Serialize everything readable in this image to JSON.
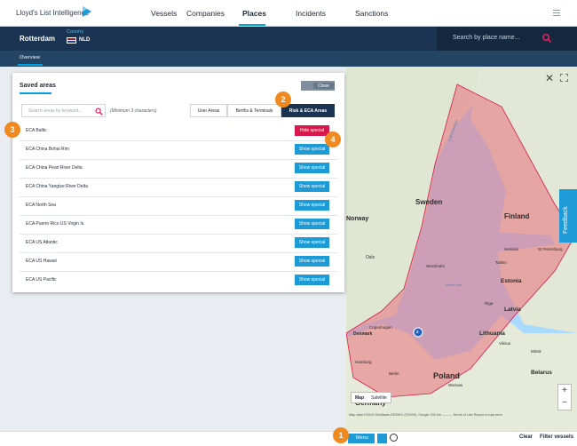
{
  "nav": {
    "brand": "Lloyd's List Intelligence",
    "items": [
      "Vessels",
      "Companies",
      "Places",
      "Incidents",
      "Sanctions"
    ],
    "active": "Places"
  },
  "place": {
    "name": "Rotterdam",
    "country_label": "Country",
    "country_code": "NLD",
    "search_placeholder": "Search by place name..."
  },
  "subnav": {
    "overview": "Overview"
  },
  "panel": {
    "title": "Saved areas",
    "close_label": "Close",
    "search_placeholder": "Search areas by keyword...",
    "min_chars_hint": "(Minimum 3 characters)",
    "tabs": [
      "User Areas",
      "Berths & Terminals",
      "Risk & ECA Areas"
    ],
    "active_tab": "Risk & ECA Areas",
    "rows": [
      {
        "label": "ECA Baltic",
        "button": "Hide special"
      },
      {
        "label": "ECA China Bohai Rim",
        "button": "Show special"
      },
      {
        "label": "ECA China Pearl River Delta",
        "button": "Show special"
      },
      {
        "label": "ECA China Yangtze River Delta",
        "button": "Show special"
      },
      {
        "label": "ECA North Sea",
        "button": "Show special"
      },
      {
        "label": "ECA Puerto Rico US Virgin Is.",
        "button": "Show special"
      },
      {
        "label": "ECA US Atlantic",
        "button": "Show special"
      },
      {
        "label": "ECA US Hawaii",
        "button": "Show special"
      },
      {
        "label": "ECA US Pacific",
        "button": "Show special"
      }
    ]
  },
  "map": {
    "labels": [
      "Sweden",
      "Finland",
      "Norway",
      "Oslo",
      "Helsinki",
      "St Petersburg",
      "Stockholm",
      "Tallinn",
      "Estonia",
      "Riga",
      "Latvia",
      "Copenhagen",
      "Denmark",
      "Lithuania",
      "Vilnius",
      "Minsk",
      "Belarus",
      "Hamburg",
      "Berlin",
      "Poland",
      "Warsaw",
      "Germany",
      "Gulf of Bothnia",
      "Baltic Sea"
    ],
    "cluster_count": "2",
    "toggle": [
      "Map",
      "Satellite"
    ],
    "attribution": "Map data ©2019 GeoBasis-DE/BKG (©2009), Google   200 km ———   Terms of Use   Report a map error",
    "feedback": "Feedback",
    "zoom_in": "+",
    "zoom_out": "−",
    "close_glyph": "✕"
  },
  "bottom": {
    "menu_label": "Menu",
    "clear": "Clear",
    "filter": "Filter vessels"
  },
  "badges": [
    "1",
    "2",
    "3",
    "4"
  ],
  "colors": {
    "navy": "#1a3350",
    "accent": "#1d9bd6",
    "hide": "#d9184b",
    "badge": "#f08a20",
    "eca_fill": "#e8707a"
  }
}
